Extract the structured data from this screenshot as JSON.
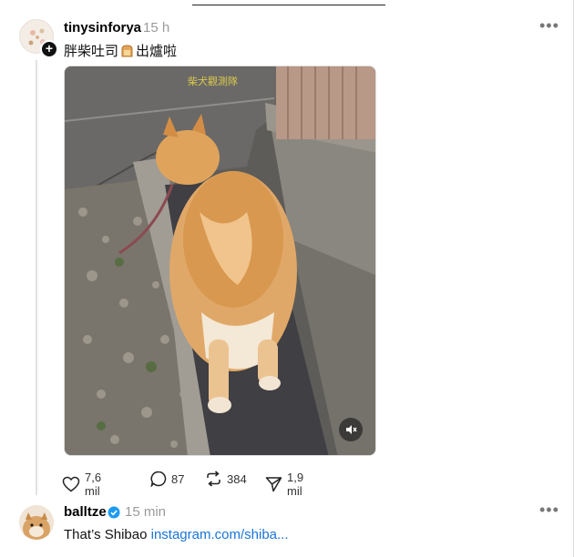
{
  "post1": {
    "username": "tinysinforya",
    "timestamp": "15 h",
    "caption_before": "胖柴吐司",
    "caption_after": "出爐啦",
    "video_overlay_text": "柴犬觀測隊",
    "likes": "7,6 mil",
    "comments": "87",
    "reposts": "384",
    "shares": "1,9 mil"
  },
  "post2": {
    "username": "balltze",
    "timestamp": "15 min",
    "caption_text": "That’s Shibao",
    "caption_link": "instagram.com/shiba..."
  },
  "colors": {
    "link": "#1a74d8",
    "verified": "#1d9bf0",
    "muted_text": "#9a9a9a"
  },
  "icons": [
    "follow-plus-icon",
    "more-icon",
    "heart-icon",
    "comment-icon",
    "repost-icon",
    "share-icon",
    "verified-badge-icon",
    "mute-icon",
    "toast-icon"
  ]
}
